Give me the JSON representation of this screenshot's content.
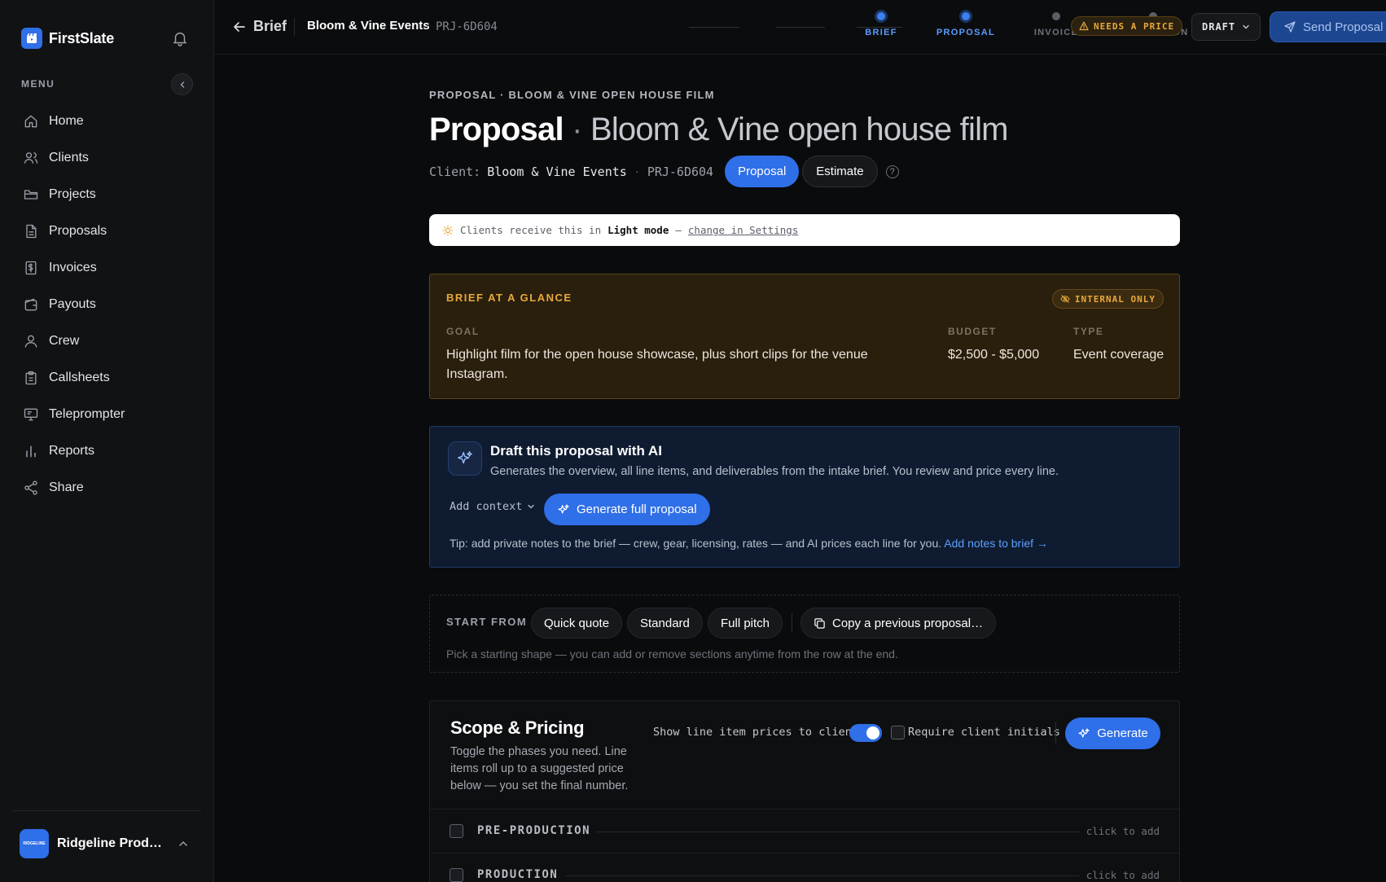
{
  "app": {
    "name": "FirstSlate"
  },
  "sidebar": {
    "menu_label": "MENU",
    "items": [
      {
        "label": "Home",
        "icon": "home-icon"
      },
      {
        "label": "Clients",
        "icon": "users-icon"
      },
      {
        "label": "Projects",
        "icon": "folder-icon"
      },
      {
        "label": "Proposals",
        "icon": "document-icon"
      },
      {
        "label": "Invoices",
        "icon": "invoice-icon"
      },
      {
        "label": "Payouts",
        "icon": "wallet-icon"
      },
      {
        "label": "Crew",
        "icon": "user-icon"
      },
      {
        "label": "Callsheets",
        "icon": "clipboard-icon"
      },
      {
        "label": "Teleprompter",
        "icon": "monitor-icon"
      },
      {
        "label": "Reports",
        "icon": "bar-chart-icon"
      },
      {
        "label": "Share",
        "icon": "share-icon"
      }
    ],
    "workspace": {
      "name": "Ridgeline Producti…",
      "avatar_text": "RIDGELINE"
    }
  },
  "topbar": {
    "back_label": "Brief",
    "client": "Bloom & Vine Events",
    "separator": "·",
    "project_id": "PRJ-6D604",
    "steps": [
      {
        "label": "BRIEF",
        "state": "done"
      },
      {
        "label": "PROPOSAL",
        "state": "active"
      },
      {
        "label": "INVOICE",
        "state": "upcoming"
      },
      {
        "label": "PRODUCTION",
        "state": "upcoming"
      }
    ],
    "needs_price_badge": "NEEDS A PRICE",
    "status_dropdown": "DRAFT",
    "send_button": "Send Proposal"
  },
  "header": {
    "eyebrow": "PROPOSAL · BLOOM & VINE OPEN HOUSE FILM",
    "title_strong": "Proposal",
    "title_sep": "·",
    "title_light": "Bloom & Vine open house film",
    "client_label": "Client:",
    "client_value": "Bloom & Vine Events",
    "meta_sep": "·",
    "project_id": "PRJ-6D604",
    "tabs": [
      {
        "label": "Proposal",
        "active": true
      },
      {
        "label": "Estimate",
        "active": false
      }
    ],
    "help_glyph": "?"
  },
  "notice": {
    "prefix": "Clients receive this in",
    "mode": "Light mode",
    "dash": "—",
    "link": "change in Settings"
  },
  "glance": {
    "title": "BRIEF AT A GLANCE",
    "badge": "INTERNAL ONLY",
    "goal_label": "GOAL",
    "goal_value": "Highlight film for the open house showcase, plus short clips for the venue Instagram.",
    "budget_label": "BUDGET",
    "budget_value": "$2,500 - $5,000",
    "type_label": "TYPE",
    "type_value": "Event coverage"
  },
  "ai": {
    "title": "Draft this proposal with AI",
    "description": "Generates the overview, all line items, and deliverables from the intake brief. You review and price every line.",
    "add_context": "Add context",
    "generate_button": "Generate full proposal",
    "tip": "Tip: add private notes to the brief — crew, gear, licensing, rates — and AI prices each line for you.",
    "tip_link": "Add notes to brief →"
  },
  "start": {
    "label": "START FROM",
    "chips": [
      "Quick quote",
      "Standard",
      "Full pitch"
    ],
    "copy_button": "Copy a previous proposal…",
    "hint": "Pick a starting shape — you can add or remove sections anytime from the row at the end."
  },
  "scope": {
    "title": "Scope & Pricing",
    "description": "Toggle the phases you need. Line items roll up to a suggested price below — you set the final number.",
    "show_prices_label": "Show line item prices to client",
    "show_prices_on": true,
    "require_initials_label": "Require client initials",
    "require_initials_checked": false,
    "generate_button": "Generate",
    "phases": [
      {
        "name": "PRE-PRODUCTION",
        "action": "click to add",
        "checked": false
      },
      {
        "name": "PRODUCTION",
        "action": "click to add",
        "checked": false
      }
    ]
  },
  "colors": {
    "accent": "#2f6fe8",
    "warning": "#e8a93b",
    "background": "#0a0b0d",
    "sidebar": "#111214"
  }
}
